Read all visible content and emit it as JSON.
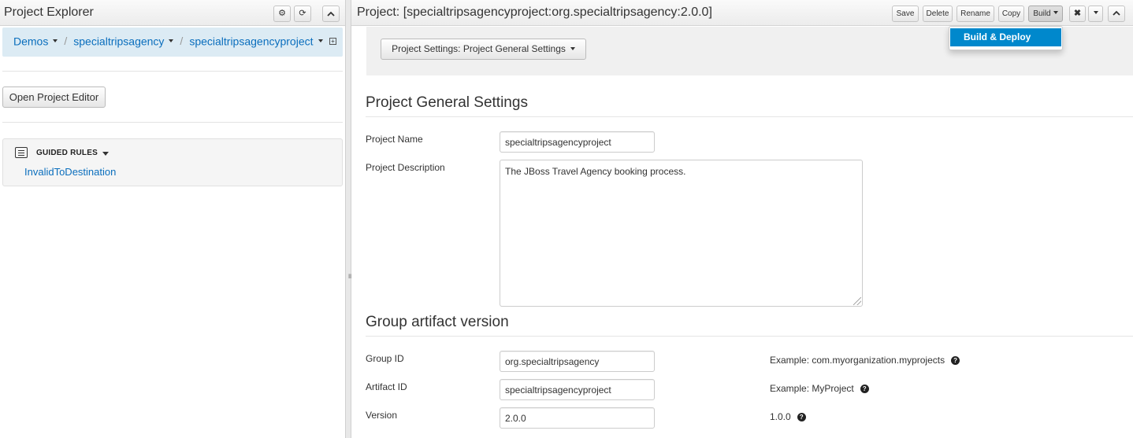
{
  "project_explorer": {
    "title": "Project Explorer",
    "icons": [
      "gear-icon",
      "refresh-icon",
      "collapse-icon"
    ],
    "breadcrumb": [
      "Demos",
      "specialtripsagency",
      "specialtripsagencyproject"
    ],
    "open_editor_label": "Open Project Editor",
    "guided_rules": {
      "title": "GUIDED RULES",
      "items": [
        "InvalidToDestination"
      ]
    }
  },
  "editor": {
    "title": "Project: [specialtripsagencyproject:org.specialtripsagency:2.0.0]",
    "toolbar": {
      "save": "Save",
      "delete": "Delete",
      "rename": "Rename",
      "copy": "Copy",
      "build": "Build"
    },
    "build_menu": [
      "Build & Deploy"
    ],
    "settings_dropdown_label": "Project Settings: Project General Settings",
    "general": {
      "heading": "Project General Settings",
      "name_label": "Project Name",
      "name_value": "specialtripsagencyproject",
      "description_label": "Project Description",
      "description_value": "The JBoss Travel Agency booking process."
    },
    "gav": {
      "heading": "Group artifact version",
      "group_label": "Group ID",
      "group_value": "org.specialtripsagency",
      "group_example": "Example: com.myorganization.myprojects",
      "artifact_label": "Artifact ID",
      "artifact_value": "specialtripsagencyproject",
      "artifact_example": "Example: MyProject",
      "version_label": "Version",
      "version_value": "2.0.0",
      "version_example": "1.0.0"
    }
  },
  "colors": {
    "link": "#0a6ebd",
    "breadcrumb_bg": "#dcebf4",
    "menu_highlight": "#0088cc"
  }
}
